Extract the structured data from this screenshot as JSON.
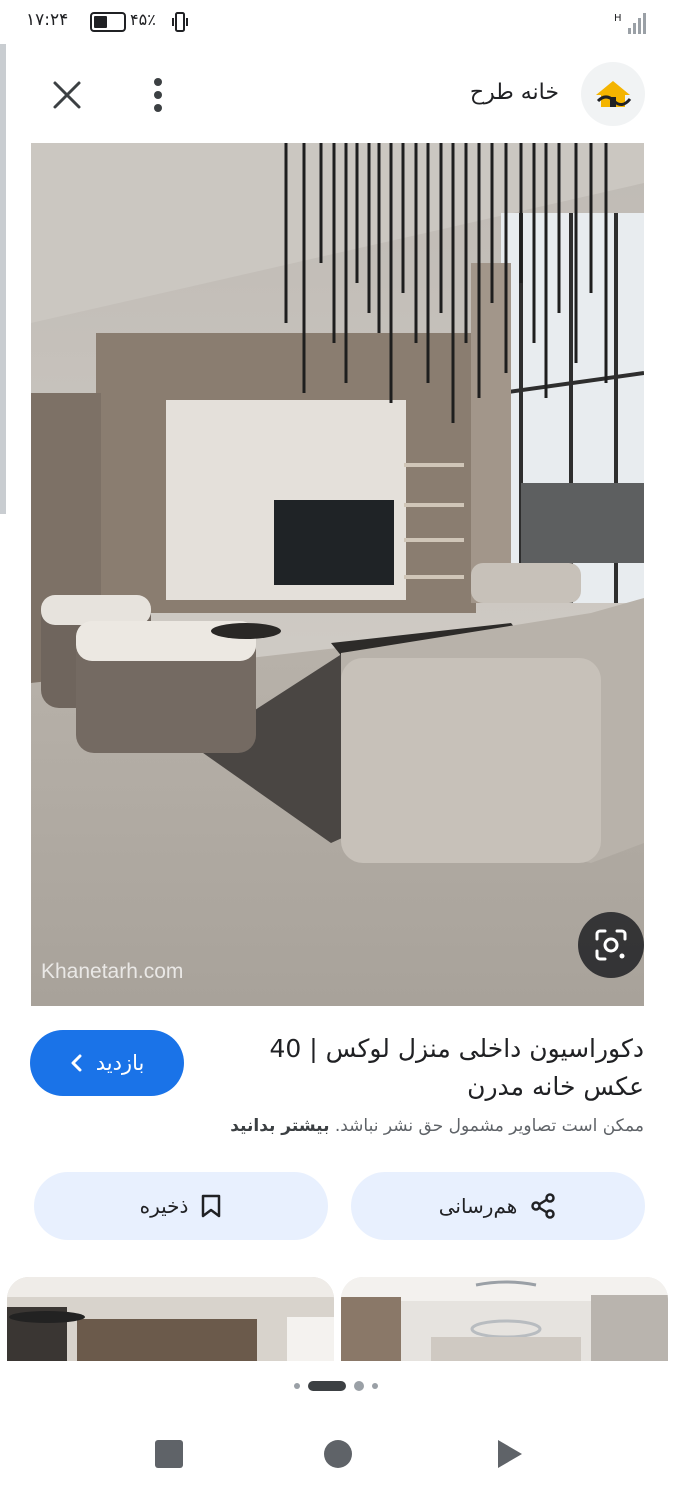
{
  "status_bar": {
    "time": "۱۷:۲۴",
    "battery_percent": "۴۵٪",
    "battery_level": 0.45,
    "network_label": "H"
  },
  "header": {
    "site_name": "خانه طرح",
    "icons": {
      "close": "close-icon",
      "more": "more-vert-icon",
      "logo": "house-logo-icon"
    }
  },
  "image": {
    "watermark": "Khanetarh.com",
    "lens_icon": "google-lens-icon"
  },
  "result": {
    "title": "دکوراسیون داخلی منزل لوکس | 40 عکس خانه مدرن",
    "visit_label": "بازدید",
    "license_text": "ممکن است تصاویر مشمول حق نشر نباشد.",
    "learn_more": "بیشتر بدانید"
  },
  "actions": {
    "share_label": "هم‌رسانی",
    "save_label": "ذخیره",
    "share_icon": "share-icon",
    "save_icon": "bookmark-icon"
  },
  "pager": {
    "count": 4,
    "active_index": 1
  },
  "colors": {
    "accent": "#1a73e8",
    "chip_bg": "#e8f0fe",
    "text": "#202124",
    "secondary": "#5f6368"
  }
}
